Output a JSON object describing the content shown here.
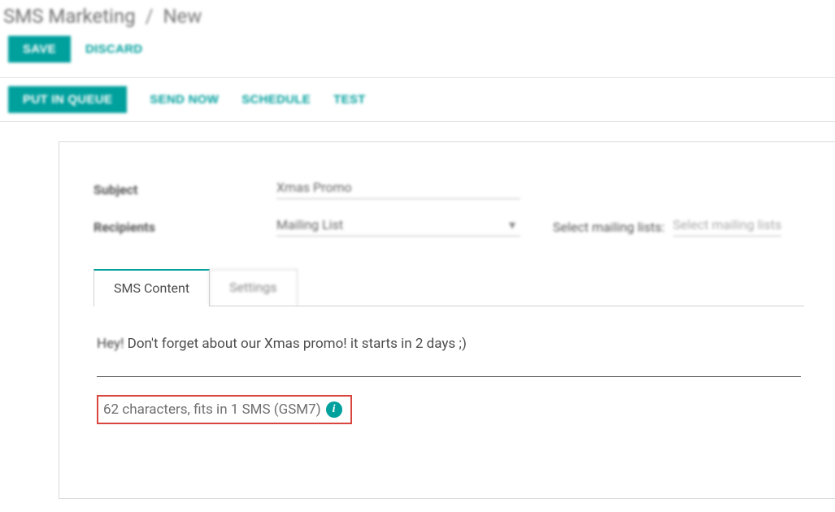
{
  "breadcrumb": {
    "root": "SMS Marketing",
    "sep": "/",
    "current": "New"
  },
  "topActions": {
    "save": "SAVE",
    "discard": "DISCARD"
  },
  "pageActions": {
    "putInQueue": "PUT IN QUEUE",
    "sendNow": "SEND NOW",
    "schedule": "SCHEDULE",
    "test": "TEST"
  },
  "form": {
    "subject": {
      "label": "Subject",
      "value": "Xmas Promo"
    },
    "recipients": {
      "label": "Recipients",
      "value": "Mailing List"
    },
    "mailing": {
      "label": "Select mailing lists:",
      "placeholder": "Select mailing lists"
    }
  },
  "tabs": {
    "smsContent": "SMS Content",
    "settings": "Settings"
  },
  "sms": {
    "prefix": "Hey!",
    "rest": " Don't forget about our Xmas promo! it starts in 2 days ;)",
    "charCount": "62 characters, fits in 1 SMS (GSM7)",
    "infoGlyph": "i"
  }
}
